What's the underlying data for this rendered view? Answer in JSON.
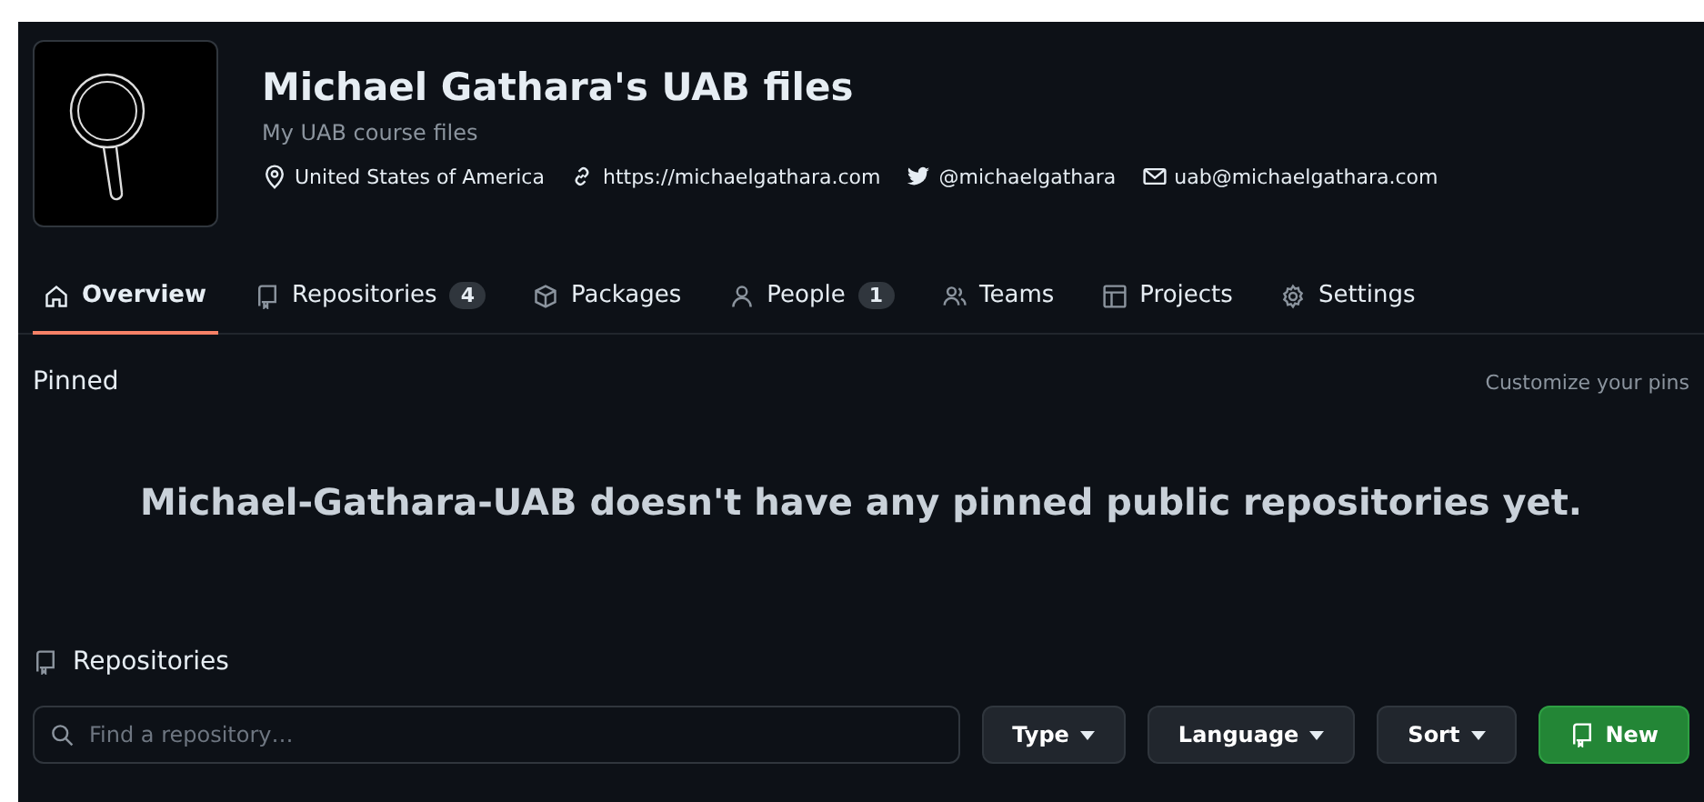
{
  "org": {
    "name": "Michael Gathara's UAB files",
    "description": "My UAB course files",
    "meta": [
      {
        "kind": "location",
        "text": "United States of America"
      },
      {
        "kind": "link",
        "text": "https://michaelgathara.com"
      },
      {
        "kind": "twitter",
        "text": "@michaelgathara"
      },
      {
        "kind": "email",
        "text": "uab@michaelgathara.com"
      }
    ]
  },
  "tabs": [
    {
      "kind": "home",
      "label": "Overview",
      "selected": true
    },
    {
      "kind": "repo",
      "label": "Repositories",
      "count": "4",
      "selected": false
    },
    {
      "kind": "package",
      "label": "Packages",
      "selected": false
    },
    {
      "kind": "person",
      "label": "People",
      "count": "1",
      "selected": false
    },
    {
      "kind": "team",
      "label": "Teams",
      "selected": false
    },
    {
      "kind": "table",
      "label": "Projects",
      "selected": false
    },
    {
      "kind": "gear",
      "label": "Settings",
      "selected": false
    }
  ],
  "pinned": {
    "title": "Pinned",
    "action": "Customize your pins",
    "empty_message": "Michael-Gathara-UAB doesn't have any pinned public repositories yet."
  },
  "repositories": {
    "title": "Repositories",
    "search": {
      "placeholder": "Find a repository…"
    },
    "filters": [
      "Type",
      "Language",
      "Sort"
    ],
    "new_button": "New"
  }
}
